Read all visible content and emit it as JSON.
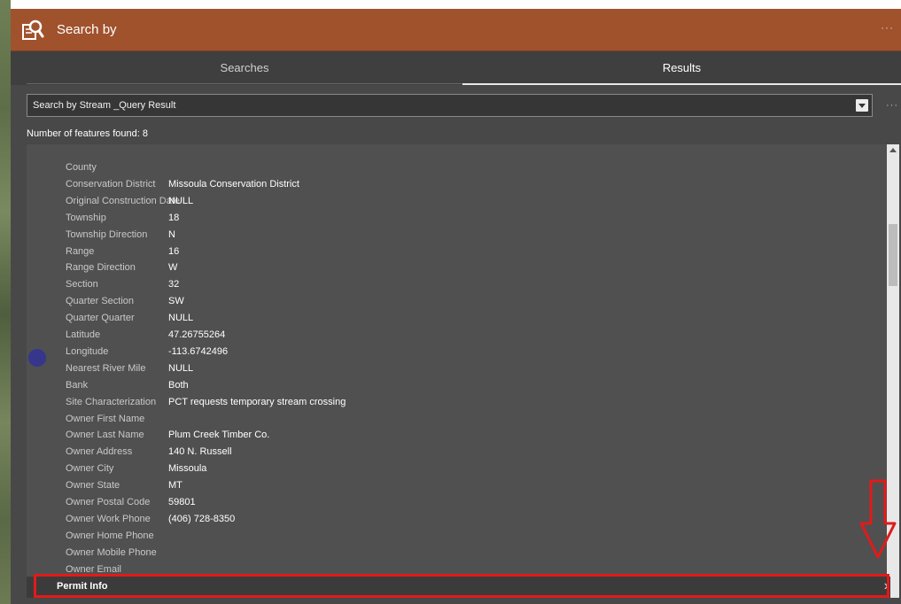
{
  "header": {
    "title": "Search by",
    "more": "···"
  },
  "tabs": [
    {
      "label": "Searches"
    },
    {
      "label": "Results"
    }
  ],
  "select": {
    "value": "Search by Stream _Query Result"
  },
  "side_more": "···",
  "feature_count": "Number of features found: 8",
  "attributes": [
    {
      "label": "County",
      "value": ""
    },
    {
      "label": "Conservation District",
      "value": "Missoula Conservation District"
    },
    {
      "label": "Original Construction Date",
      "value": "NULL"
    },
    {
      "label": "Township",
      "value": "18"
    },
    {
      "label": "Township Direction",
      "value": "N"
    },
    {
      "label": "Range",
      "value": "16"
    },
    {
      "label": "Range Direction",
      "value": "W"
    },
    {
      "label": "Section",
      "value": "32"
    },
    {
      "label": "Quarter Section",
      "value": "SW"
    },
    {
      "label": "Quarter Quarter",
      "value": "NULL"
    },
    {
      "label": "Latitude",
      "value": "47.26755264"
    },
    {
      "label": "Longitude",
      "value": "-113.6742496"
    },
    {
      "label": "Nearest River Mile",
      "value": "NULL"
    },
    {
      "label": "Bank",
      "value": "Both"
    },
    {
      "label": "Site Characterization",
      "value": "PCT requests temporary stream crossing"
    },
    {
      "label": "Owner First Name",
      "value": ""
    },
    {
      "label": "Owner Last Name",
      "value": "Plum Creek Timber Co."
    },
    {
      "label": "Owner Address",
      "value": "140 N. Russell"
    },
    {
      "label": "Owner City",
      "value": "Missoula"
    },
    {
      "label": "Owner State",
      "value": "MT"
    },
    {
      "label": "Owner Postal Code",
      "value": "59801"
    },
    {
      "label": "Owner Work Phone",
      "value": "(406) 728-8350"
    },
    {
      "label": "Owner Home Phone",
      "value": ""
    },
    {
      "label": "Owner Mobile Phone",
      "value": ""
    },
    {
      "label": "Owner Email",
      "value": ""
    }
  ],
  "permit": {
    "label": "Permit Info",
    "chevron": "›"
  },
  "colors": {
    "header": "#a0522d",
    "panel": "#484848",
    "highlight": "#e21a1a",
    "marker": "#36368c"
  },
  "icons": {
    "header": "search-document-icon",
    "dropdown": "caret-down-icon",
    "permit": "chevron-right-icon",
    "annotation": "down-arrow-icon"
  }
}
